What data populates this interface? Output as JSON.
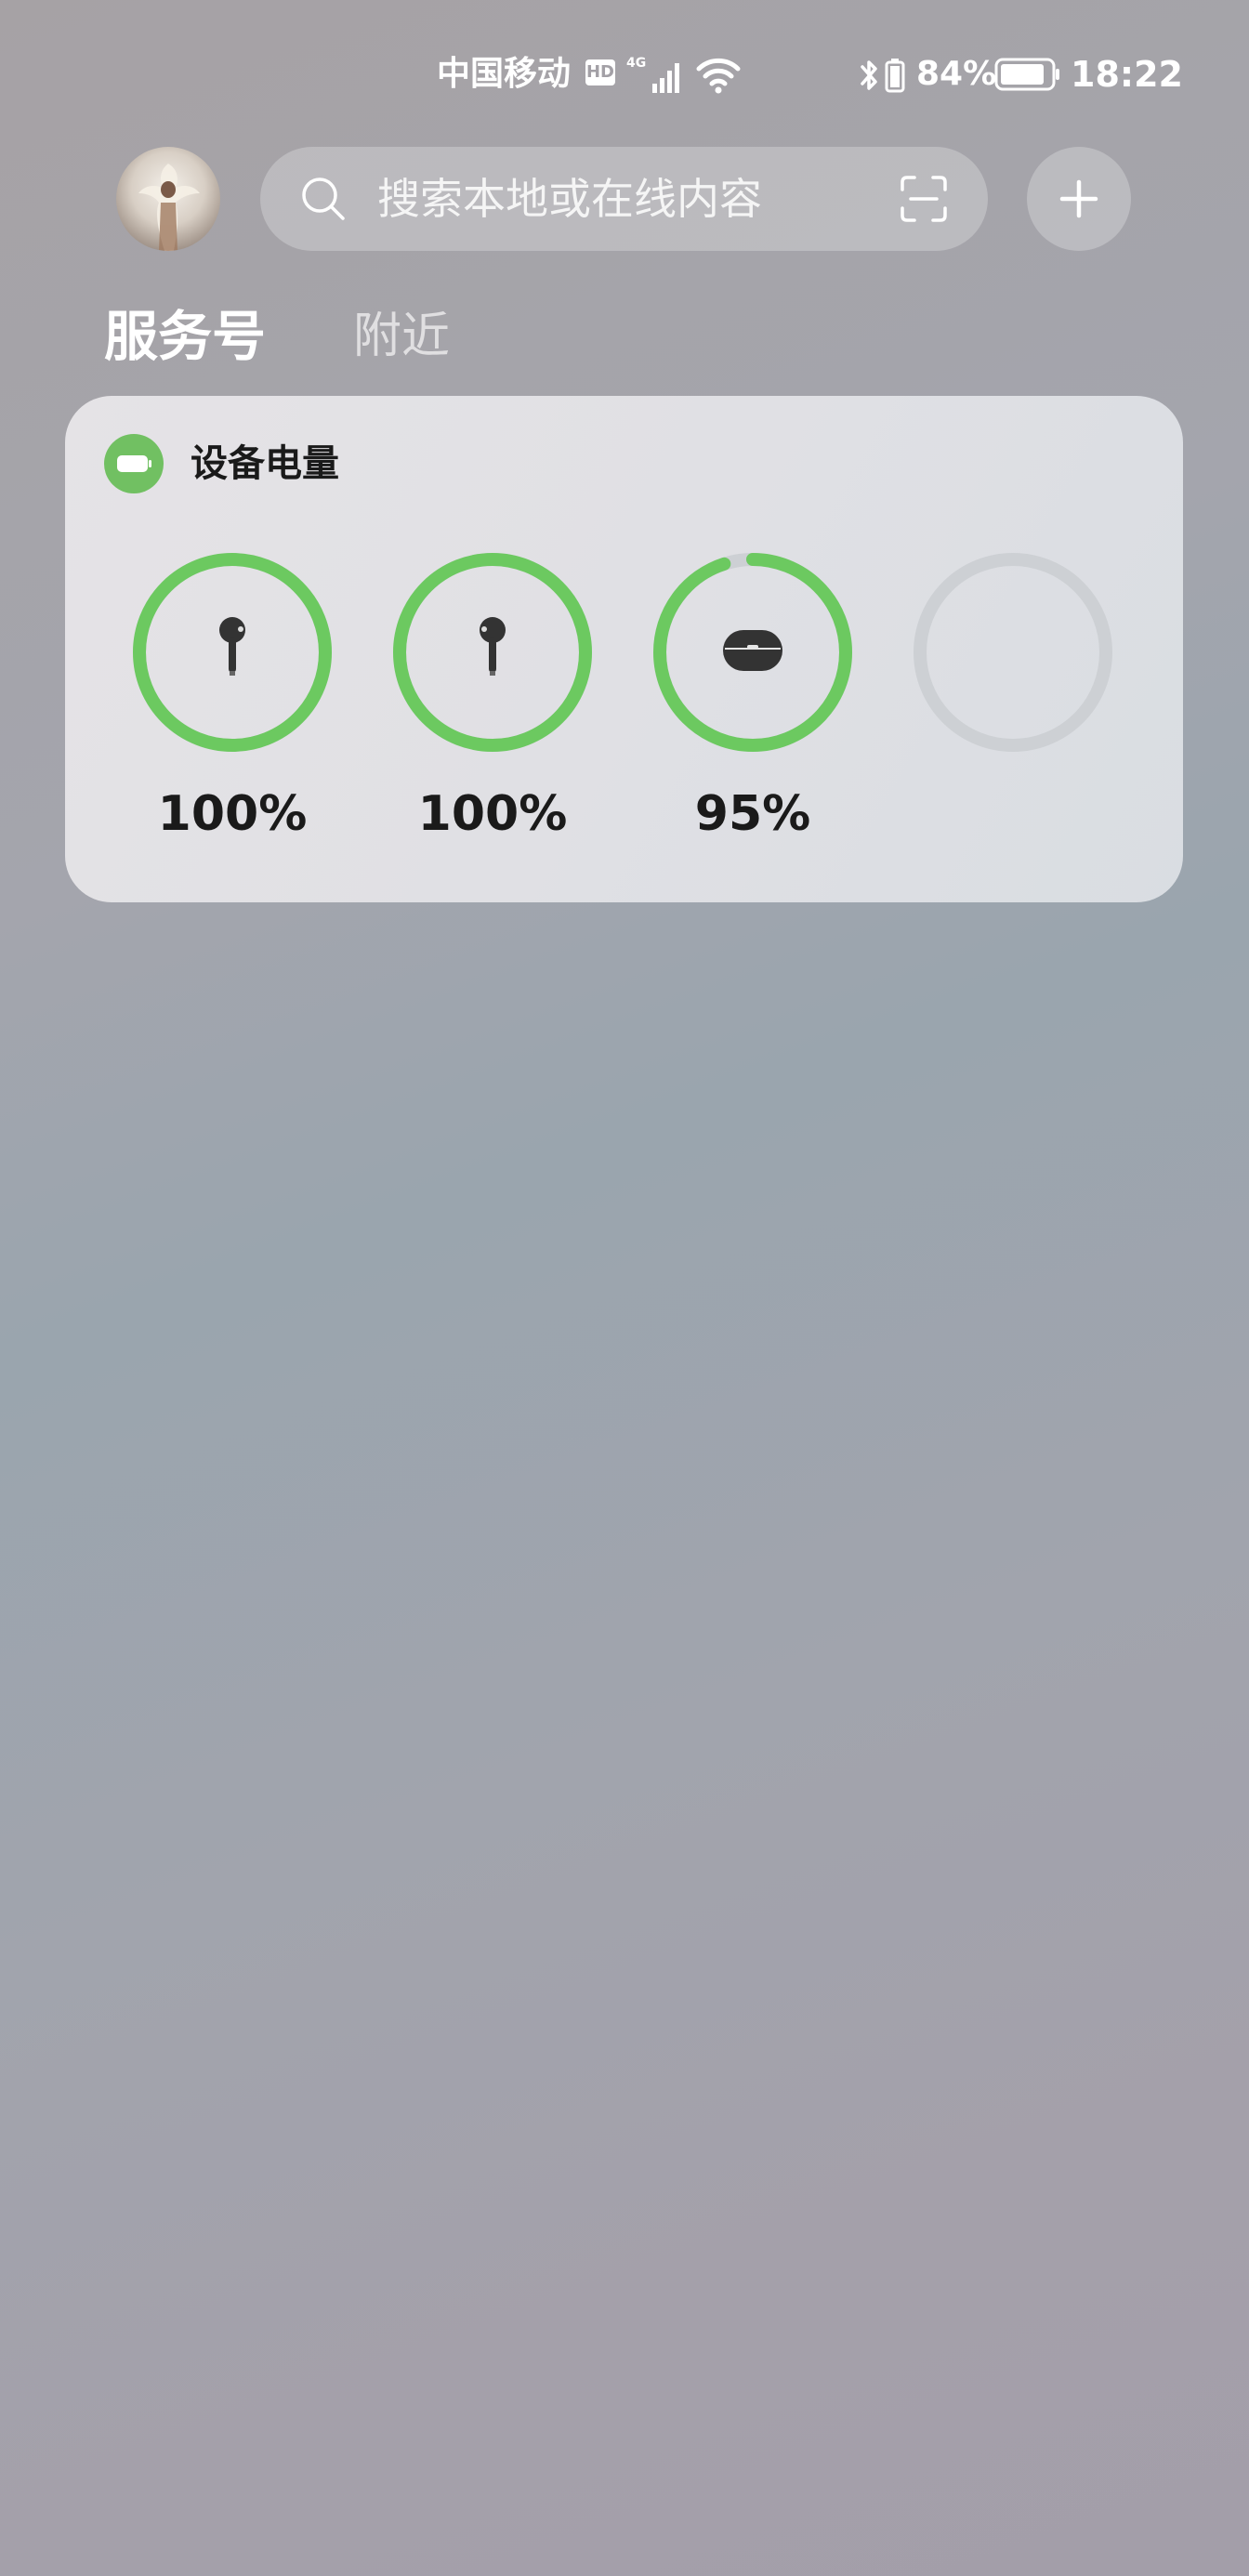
{
  "status_bar": {
    "carrier": "中国移动",
    "hd_badge": "HD",
    "network": "4G",
    "battery_percent": "84%",
    "time": "18:22"
  },
  "header": {
    "search_placeholder": "搜索本地或在线内容"
  },
  "tabs": [
    {
      "label": "服务号",
      "active": true
    },
    {
      "label": "附近",
      "active": false
    }
  ],
  "battery_card": {
    "title": "设备电量",
    "accent_color": "#6cc960",
    "devices": [
      {
        "icon": "left-earbud-icon",
        "level": 1.0,
        "label": "100%"
      },
      {
        "icon": "right-earbud-icon",
        "level": 1.0,
        "label": "100%"
      },
      {
        "icon": "charging-case-icon",
        "level": 0.95,
        "label": "95%"
      },
      {
        "icon": "",
        "level": 0,
        "label": ""
      }
    ]
  }
}
